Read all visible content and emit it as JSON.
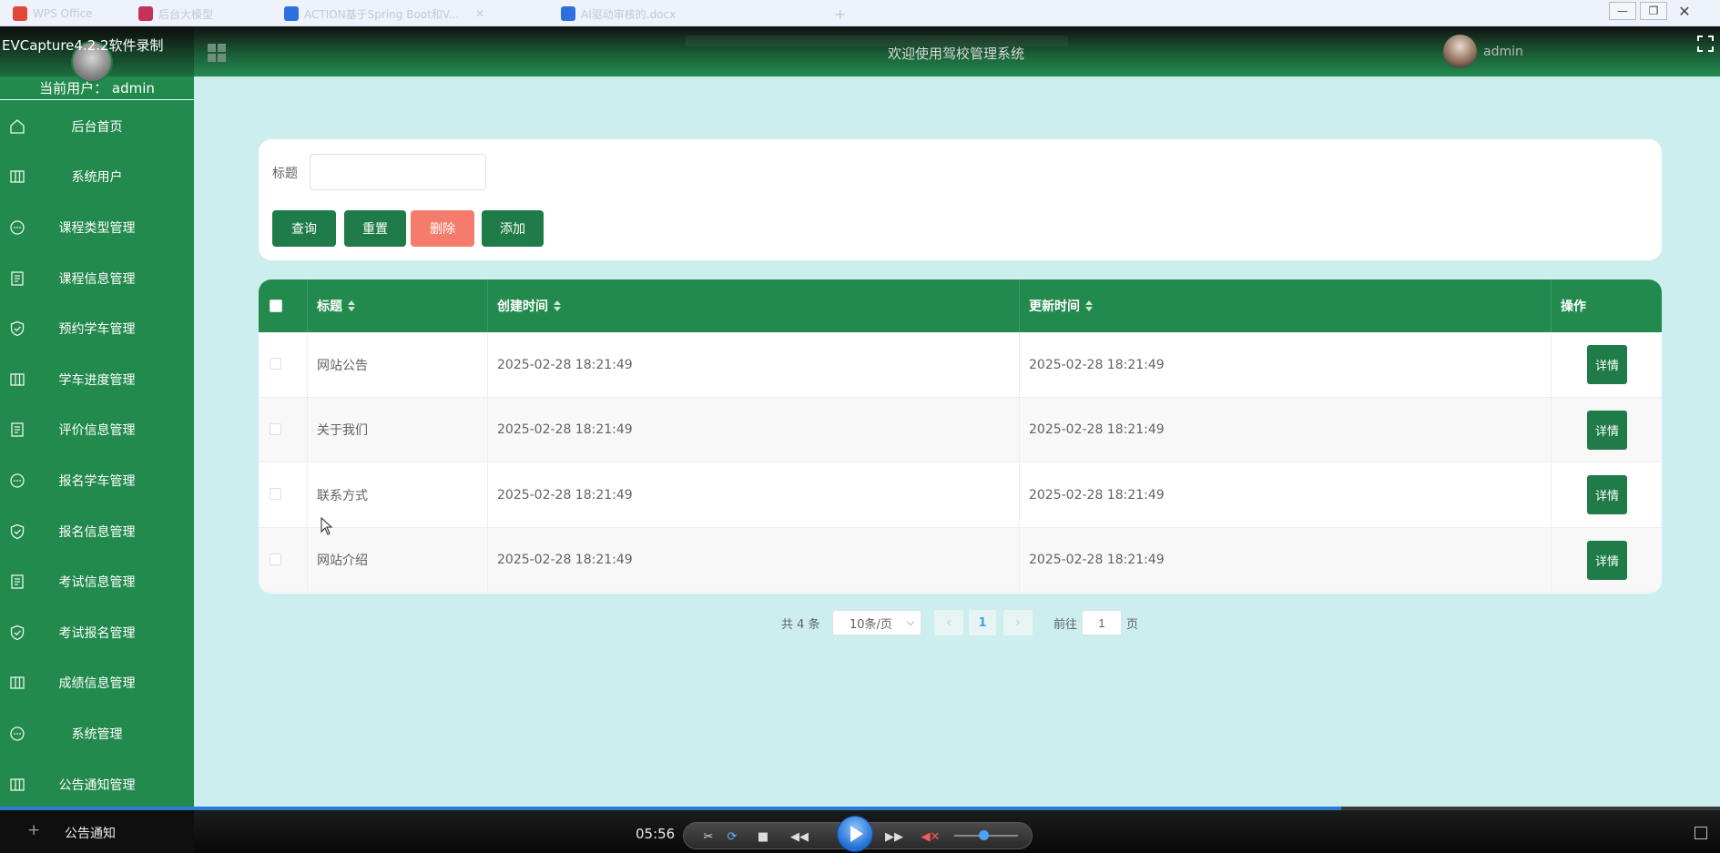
{
  "os_tabs": [
    {
      "label": "WPS Office",
      "color": "#e2463a"
    },
    {
      "label": "后台大模型",
      "color": "#c6315a"
    },
    {
      "label": "ACTION基于Spring Boot和V...",
      "color": "#2e6fe0"
    },
    {
      "label": "AI驱动审核的.docx",
      "color": "#2e6fe0"
    }
  ],
  "sidebar": {
    "brand": "EVCapture4.2.2软件录制",
    "current_user": "当前用户： admin",
    "items": [
      {
        "label": "后台首页",
        "icon": "home-icon"
      },
      {
        "label": "系统用户",
        "icon": "columns-icon"
      },
      {
        "label": "课程类型管理",
        "icon": "chat-icon"
      },
      {
        "label": "课程信息管理",
        "icon": "document-icon"
      },
      {
        "label": "预约学车管理",
        "icon": "shield-check-icon"
      },
      {
        "label": "学车进度管理",
        "icon": "columns-icon"
      },
      {
        "label": "评价信息管理",
        "icon": "document-icon"
      },
      {
        "label": "报名学车管理",
        "icon": "chat-icon"
      },
      {
        "label": "报名信息管理",
        "icon": "shield-check-icon"
      },
      {
        "label": "考试信息管理",
        "icon": "document-icon"
      },
      {
        "label": "考试报名管理",
        "icon": "shield-check-icon"
      },
      {
        "label": "成绩信息管理",
        "icon": "columns-icon"
      },
      {
        "label": "系统管理",
        "icon": "chat-icon"
      },
      {
        "label": "公告通知管理",
        "icon": "columns-icon"
      }
    ],
    "bottom_plus": "+",
    "bottom_label": "公告通知"
  },
  "header": {
    "welcome": "欢迎使用驾校管理系统",
    "user": "admin"
  },
  "search": {
    "label": "标题",
    "value": "",
    "buttons": {
      "query": "查询",
      "reset": "重置",
      "delete": "删除",
      "add": "添加"
    }
  },
  "table": {
    "columns": [
      "标题",
      "创建时间",
      "更新时间",
      "操作"
    ],
    "rows": [
      {
        "title": "网站公告",
        "created": "2025-02-28 18:21:49",
        "updated": "2025-02-28 18:21:49",
        "action": "详情"
      },
      {
        "title": "关于我们",
        "created": "2025-02-28 18:21:49",
        "updated": "2025-02-28 18:21:49",
        "action": "详情"
      },
      {
        "title": "联系方式",
        "created": "2025-02-28 18:21:49",
        "updated": "2025-02-28 18:21:49",
        "action": "详情"
      },
      {
        "title": "网站介绍",
        "created": "2025-02-28 18:21:49",
        "updated": "2025-02-28 18:21:49",
        "action": "详情"
      }
    ]
  },
  "pagination": {
    "total": "共 4 条",
    "page_size": "10条/页",
    "current_page": "1",
    "goto_label": "前往",
    "goto_value": "1",
    "page_suffix": "页"
  },
  "media": {
    "time": "05:56",
    "progress": 0.78,
    "volume": 0.45
  },
  "colors": {
    "sidebar": "#238a4d",
    "button_green": "#1f7b47",
    "button_red": "#f57b6c",
    "background": "#cdeeee"
  }
}
